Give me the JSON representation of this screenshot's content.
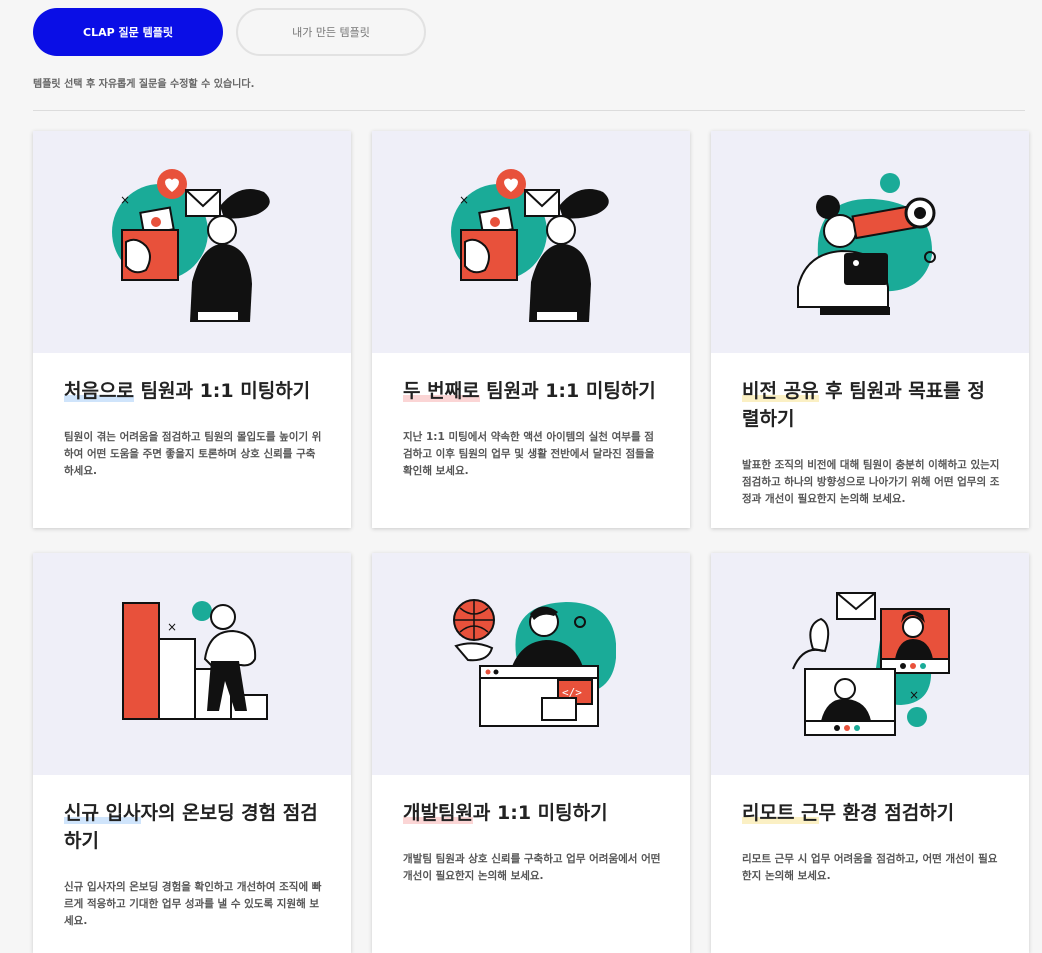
{
  "tabs": {
    "active": "CLAP 질문 템플릿",
    "inactive": "내가 만든 템플릿"
  },
  "hint": "템플릿 선택 후 자유롭게 질문을 수정할 수 있습니다.",
  "colors": {
    "accent": "#0a0ee6",
    "teal": "#1aab98",
    "red": "#e8513b"
  },
  "cards": [
    {
      "title_hl": "처음으로",
      "title_rest": " 팀원과 1:1 미팅하기",
      "hl_color": "#cfe4fb",
      "desc": "팀원이 겪는 어려움을 점검하고 팀원의 몰입도를 높이기 위하여 어떤 도움을 주면 좋을지 토론하며 상호 신뢰를 구축하세요.",
      "illustration": "mail-heart-person"
    },
    {
      "title_hl": "두 번째로",
      "title_rest": " 팀원과 1:1 미팅하기",
      "hl_color": "#fbd5d5",
      "desc": "지난 1:1 미팅에서 약속한 액션 아이템의 실천 여부를 점검하고 이후 팀원의 업무 및 생활 전반에서 달라진 점들을 확인해 보세요.",
      "illustration": "mail-heart-person"
    },
    {
      "title_hl": "비전 공유",
      "title_rest": " 후 팀원과 목표를 정렬하기",
      "hl_color": "#fbf0c4",
      "desc": "발표한 조직의 비전에 대해 팀원이 충분히 이해하고 있는지 점검하고 하나의 방향성으로 나아가기 위해 어떤 업무의 조정과 개선이 필요한지 논의해 보세요.",
      "illustration": "telescope-person"
    },
    {
      "title_hl": "신규 입사",
      "title_rest": "자의 온보딩 경험 점검하기",
      "hl_color": "#cfe4fb",
      "desc": "신규 입사자의 온보딩 경험을 확인하고 개선하여 조직에 빠르게 적응하고 기대한 업무 성과를 낼 수 있도록 지원해 보세요.",
      "illustration": "stairs-person"
    },
    {
      "title_hl": "개발팀원",
      "title_rest": "과 1:1 미팅하기",
      "hl_color": "#fbd5d5",
      "desc": "개발팀 팀원과 상호 신뢰를 구축하고 업무 어려움에서 어떤 개선이 필요한지 논의해 보세요.",
      "illustration": "developer-globe"
    },
    {
      "title_hl": "리모트 근",
      "title_rest": "무 환경 점검하기",
      "hl_color": "#fbf0c4",
      "desc": "리모트 근무 시 업무 어려움을 점검하고, 어떤 개선이 필요한지 논의해 보세요.",
      "illustration": "remote-video-call"
    }
  ]
}
